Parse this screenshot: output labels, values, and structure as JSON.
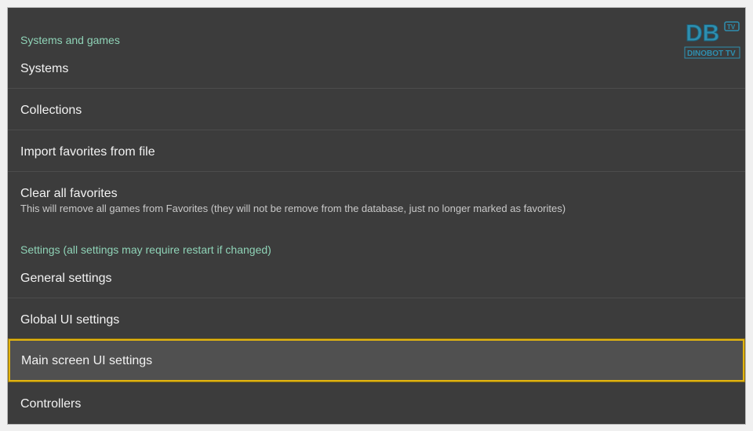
{
  "sections": {
    "systems_header": "Systems and games",
    "settings_header": "Settings (all settings may require restart if changed)"
  },
  "items": {
    "systems": "Systems",
    "collections": "Collections",
    "import_favorites": "Import favorites from file",
    "clear_favorites": "Clear all favorites",
    "clear_favorites_desc": "This will remove all games from Favorites (they will not be remove from the database, just no longer marked as favorites)",
    "general_settings": "General settings",
    "global_ui_settings": "Global UI settings",
    "main_screen_ui_settings": "Main screen UI settings",
    "controllers": "Controllers"
  },
  "watermark": {
    "logo_text": "DB",
    "badge": "TV",
    "brand": "DINOBOT TV"
  },
  "colors": {
    "background": "#3c3c3c",
    "section_header": "#8fd3b7",
    "selected_border": "#e2b410",
    "selected_bg": "#505050"
  }
}
